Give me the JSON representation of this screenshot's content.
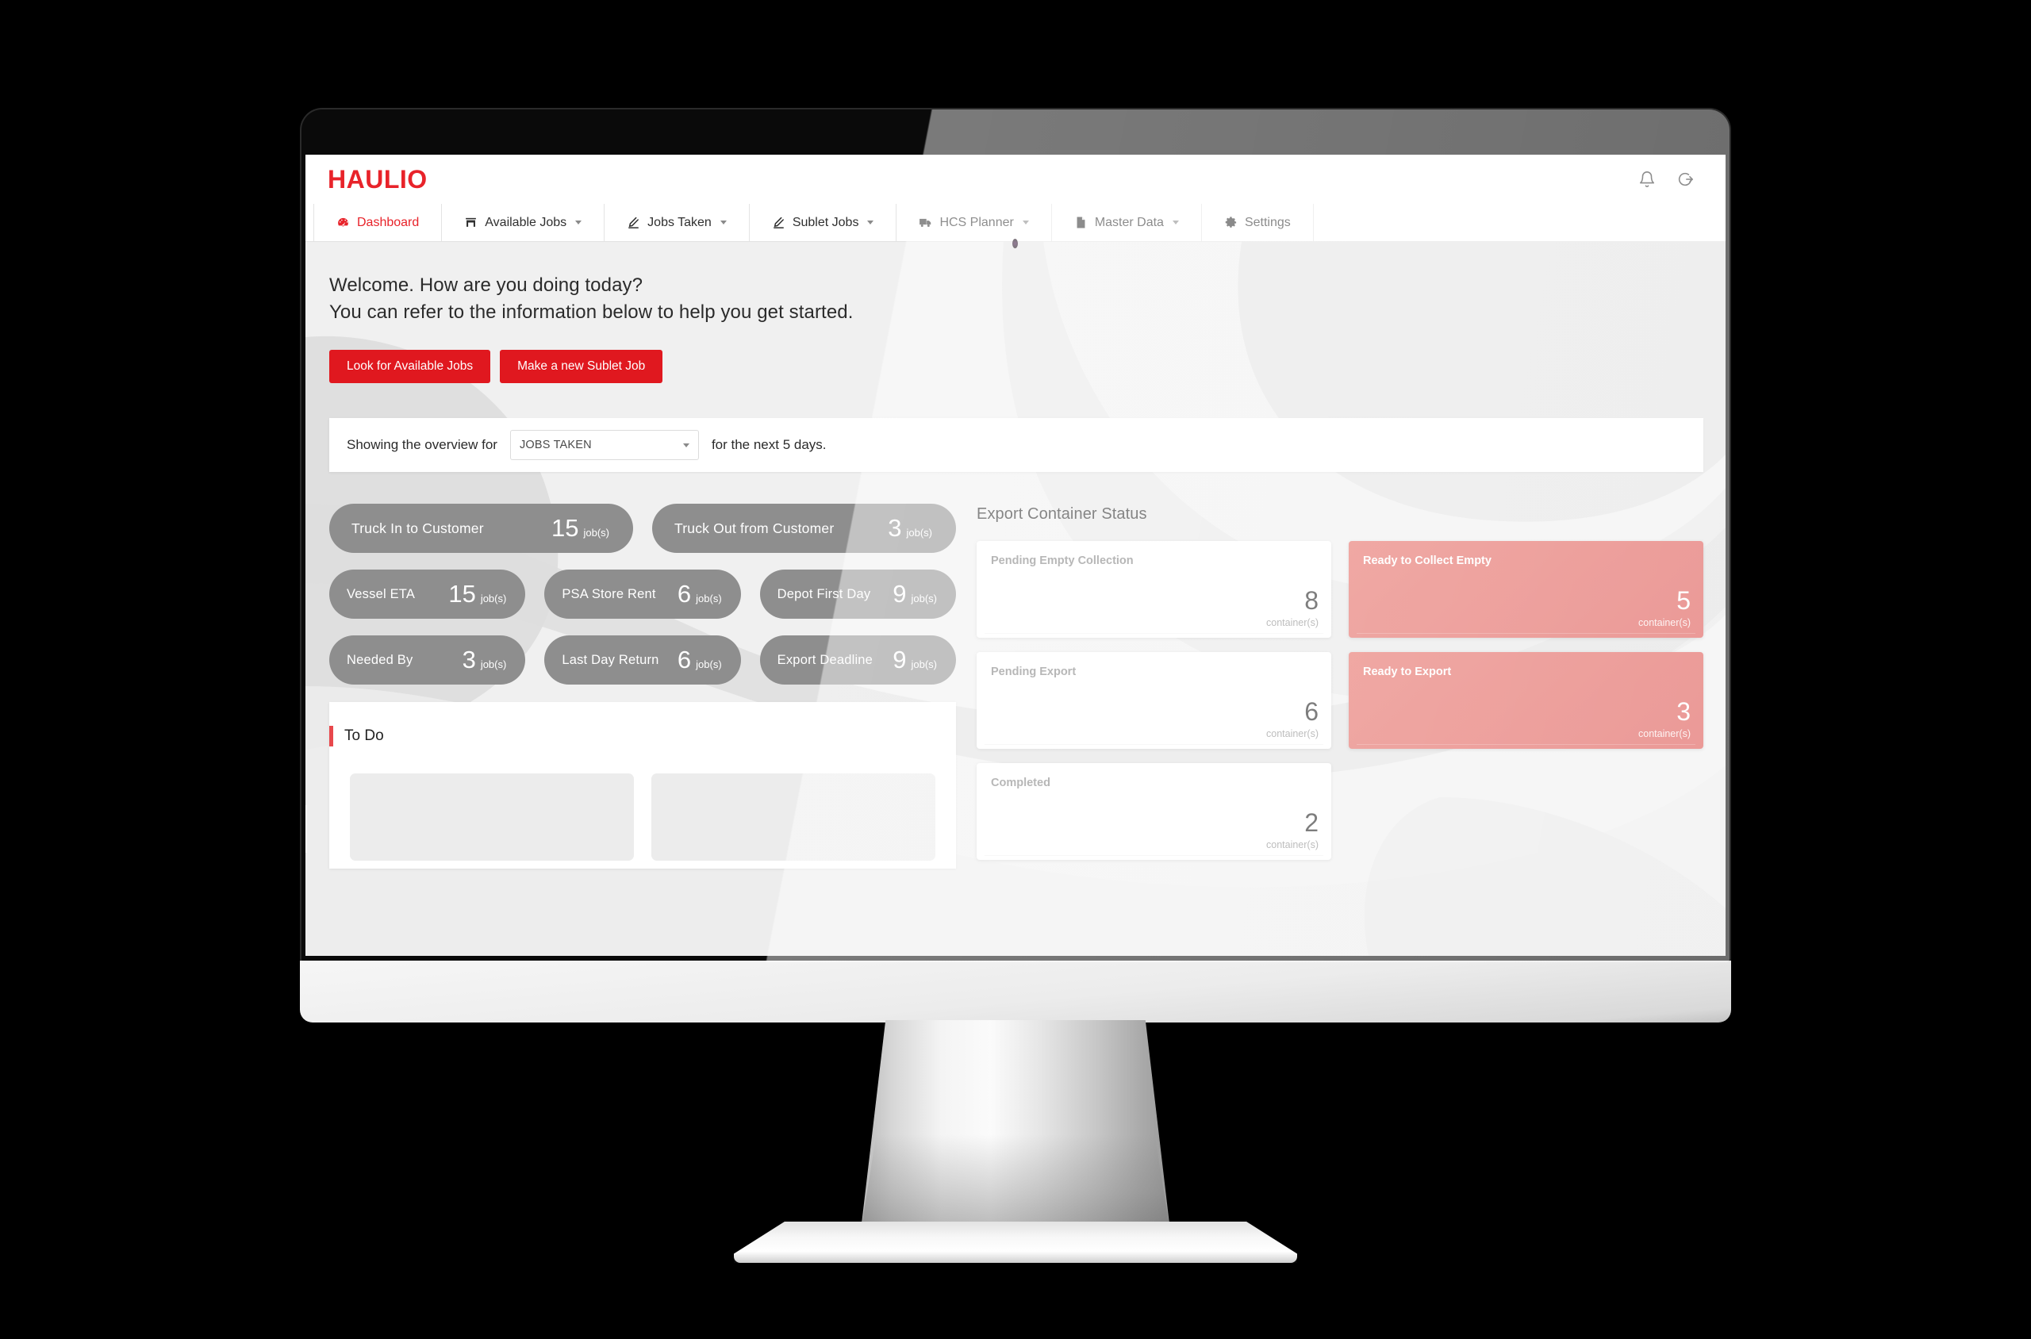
{
  "brand": {
    "logo_text": "HAULIO",
    "accent_red": "#e8232a",
    "button_red": "#e0181f",
    "pill_gray": "#8e8e8e",
    "card_accent": "#dd5551"
  },
  "header": {
    "notification_icon": "bell-icon",
    "logout_icon": "logout-icon"
  },
  "nav": {
    "items": [
      {
        "label": "Dashboard",
        "icon": "dashboard-gauge-icon",
        "caret": false,
        "active": true
      },
      {
        "label": "Available Jobs",
        "icon": "store-icon",
        "caret": true,
        "active": false
      },
      {
        "label": "Jobs Taken",
        "icon": "pen-icon",
        "caret": true,
        "active": false
      },
      {
        "label": "Sublet Jobs",
        "icon": "pen-icon",
        "caret": true,
        "active": false
      },
      {
        "label": "HCS Planner",
        "icon": "truck-icon",
        "caret": true,
        "active": false
      },
      {
        "label": "Master Data",
        "icon": "document-icon",
        "caret": true,
        "active": false
      },
      {
        "label": "Settings",
        "icon": "gear-icon",
        "caret": false,
        "active": false
      }
    ]
  },
  "welcome": {
    "line1": "Welcome. How are you doing today?",
    "line2": "You can refer to the information below to help you get started."
  },
  "cta": {
    "available_jobs": "Look for Available Jobs",
    "sublet_job": "Make a new Sublet Job"
  },
  "overview": {
    "prefix": "Showing the overview for",
    "selected": "JOBS TAKEN",
    "suffix": "for the next 5 days.",
    "dropdown_icon": "chevron-down-icon"
  },
  "stats": {
    "unit": "job(s)",
    "row1": [
      {
        "label": "Truck In to Customer",
        "value": "15"
      },
      {
        "label": "Truck Out from Customer",
        "value": "3"
      }
    ],
    "row2": [
      {
        "label": "Vessel ETA",
        "value": "15"
      },
      {
        "label": "PSA Store Rent",
        "value": "6"
      },
      {
        "label": "Depot First Day",
        "value": "9"
      }
    ],
    "row3": [
      {
        "label": "Needed By",
        "value": "3"
      },
      {
        "label": "Last Day Return",
        "value": "6"
      },
      {
        "label": "Export Deadline",
        "value": "9"
      }
    ]
  },
  "todo": {
    "title": "To Do"
  },
  "export_status": {
    "title": "Export Container Status",
    "unit": "container(s)",
    "cards": [
      {
        "label": "Pending Empty Collection",
        "value": "8",
        "style": "light"
      },
      {
        "label": "Ready to Collect Empty",
        "value": "5",
        "style": "accent"
      },
      {
        "label": "Pending Export",
        "value": "6",
        "style": "light"
      },
      {
        "label": "Ready to Export",
        "value": "3",
        "style": "accent"
      },
      {
        "label": "Completed",
        "value": "2",
        "style": "light"
      }
    ]
  }
}
